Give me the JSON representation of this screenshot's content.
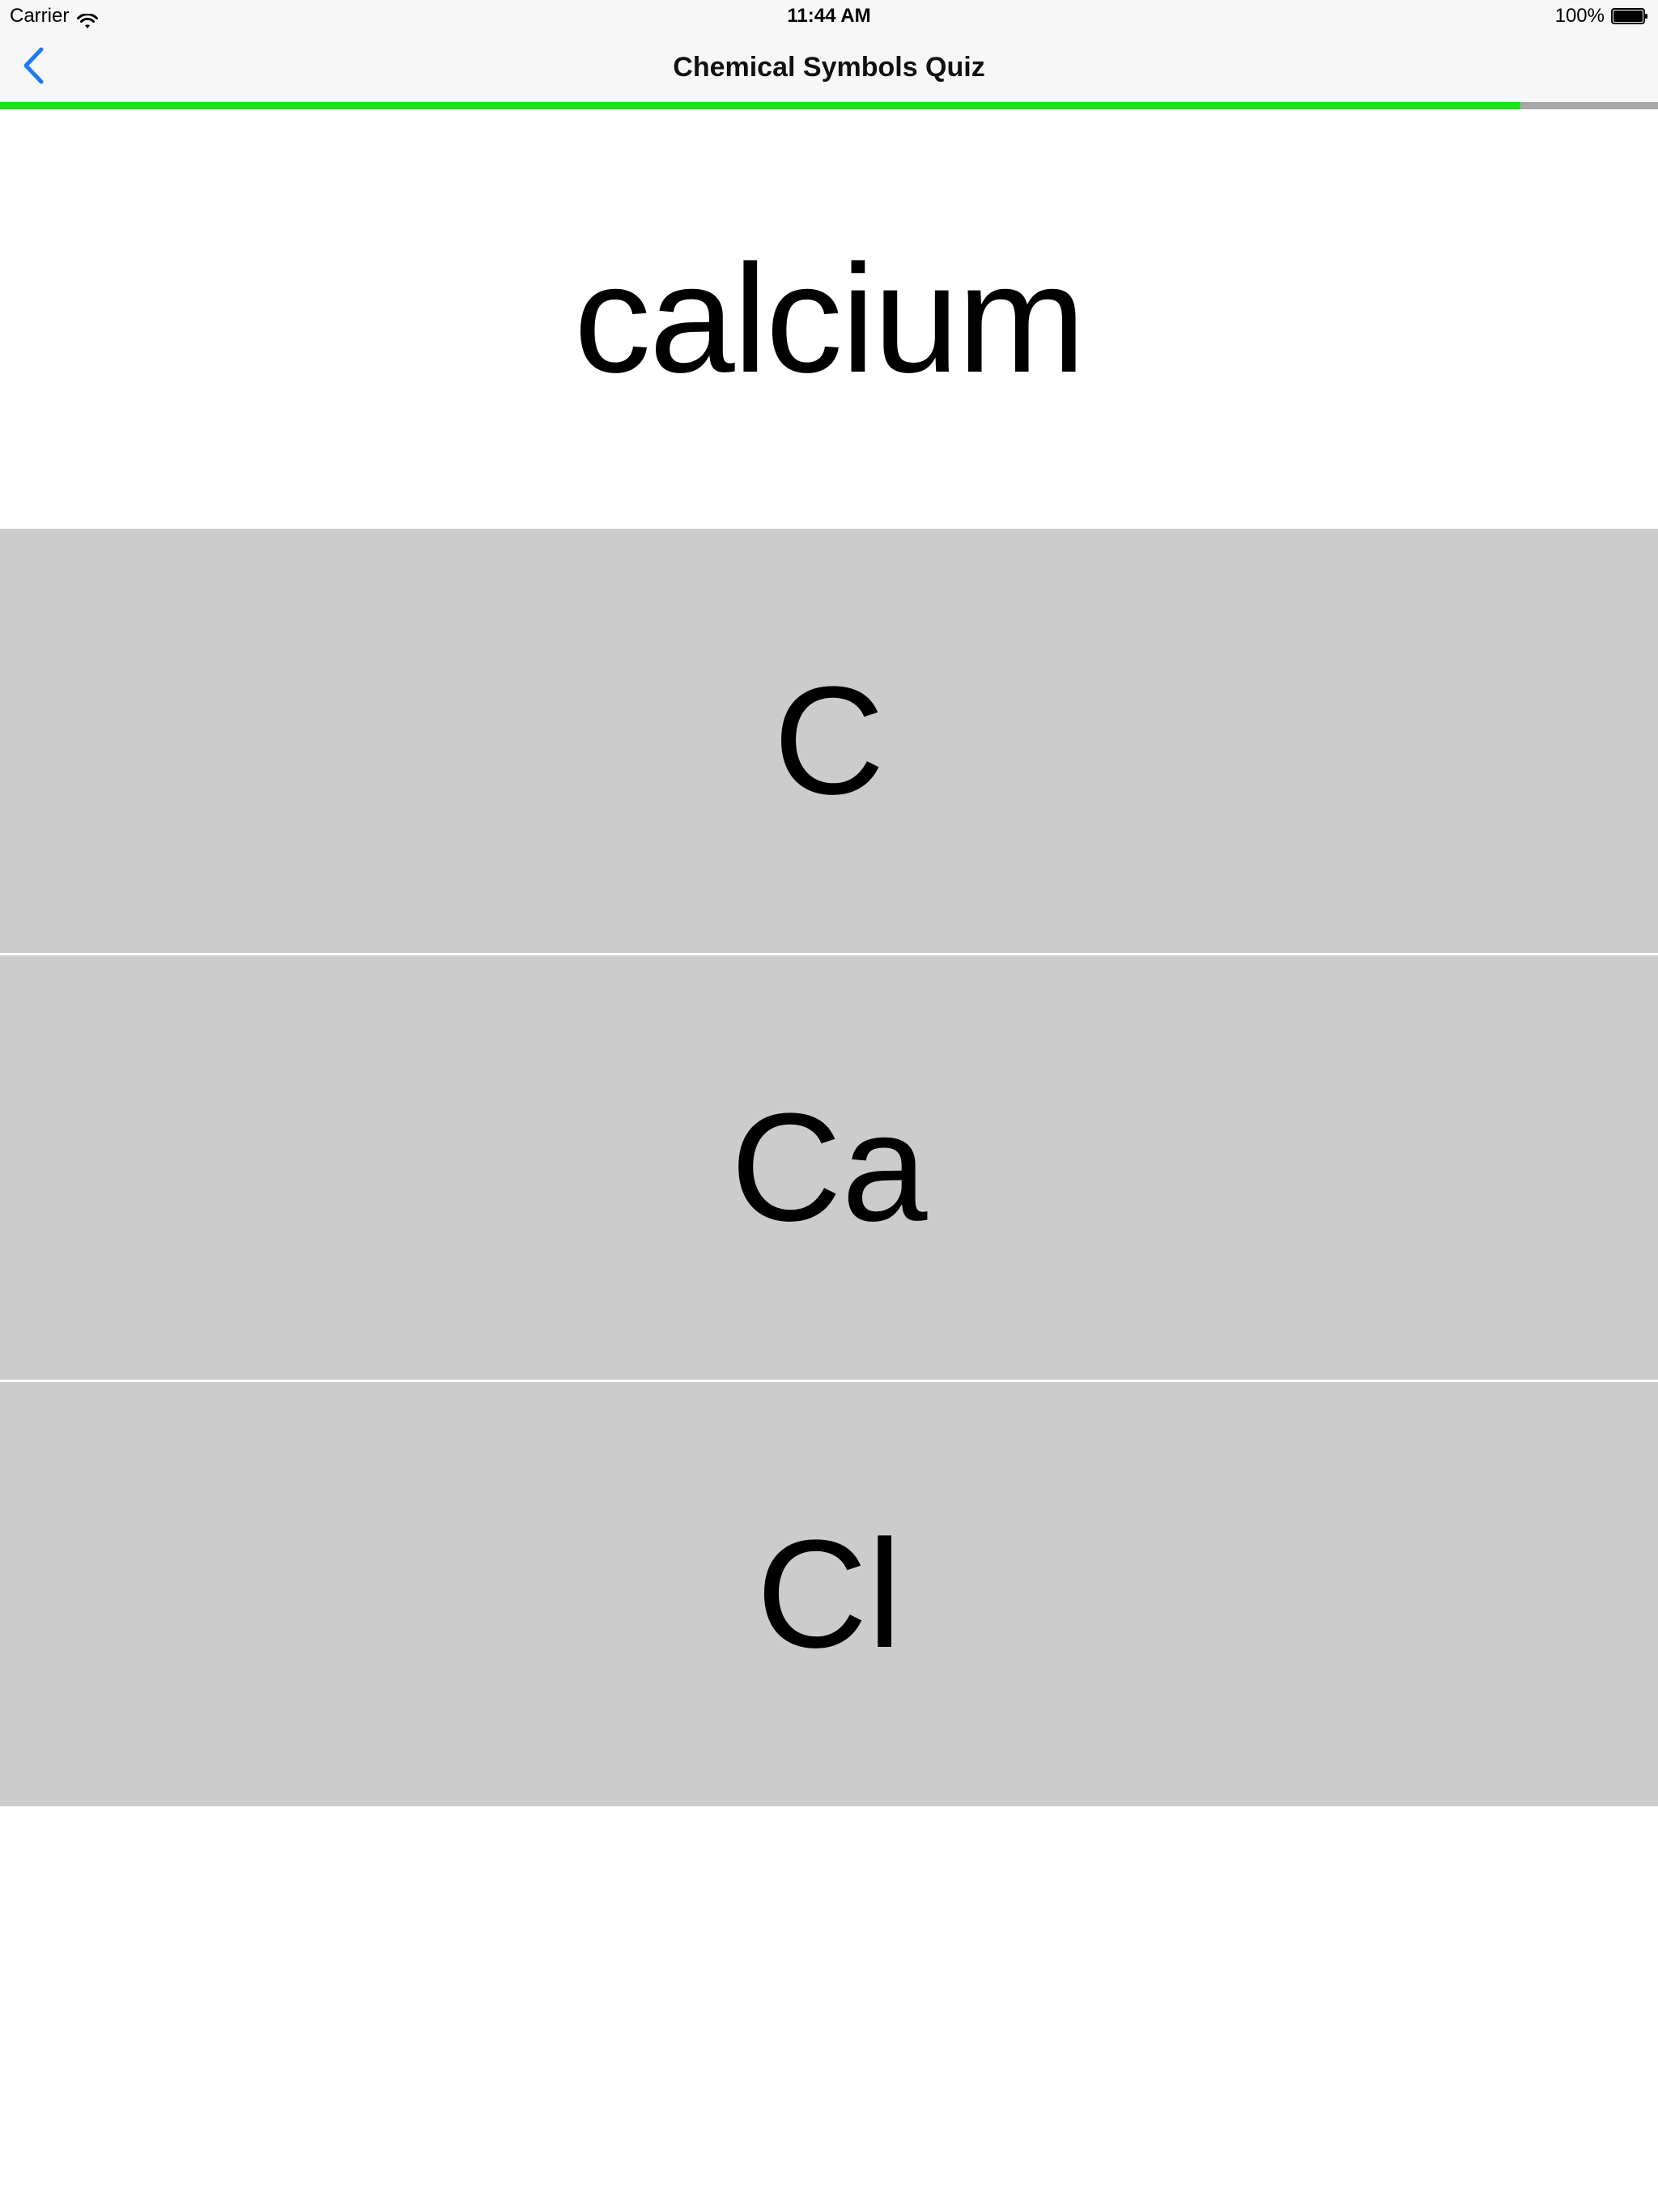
{
  "status_bar": {
    "carrier": "Carrier",
    "time": "11:44 AM",
    "battery": "100%",
    "wifi_icon": "wifi-icon",
    "battery_icon": "battery-icon"
  },
  "nav": {
    "title": "Chemical Symbols Quiz",
    "back_icon": "chevron-left-icon",
    "accent_color": "#1a7cf5"
  },
  "progress": {
    "fraction": 0.917,
    "fill_color": "#1fe01f",
    "track_color": "#a8a8a8"
  },
  "question": {
    "text": "calcium"
  },
  "answers": [
    {
      "label": "C"
    },
    {
      "label": "Ca"
    },
    {
      "label": "Cl"
    }
  ]
}
